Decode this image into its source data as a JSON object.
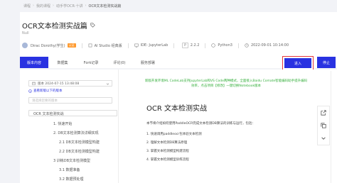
{
  "breadcrumb": [
    "课程",
    "我的课程",
    "动手学OCR·十讲",
    "OCR文本检测实战篇"
  ],
  "project": {
    "title": "OCR文本检测实战篇",
    "subtitle": "Null",
    "author": "Dirac Dorothy(学生)",
    "badge": "认证",
    "env": "AI Studio 经典版",
    "ide": "IDE: JupyterLab",
    "paddle_version": "2.2.2",
    "python": "Python3",
    "date": "2022-09-01 10:14:00"
  },
  "tabs": [
    {
      "label": "版本内容",
      "active": true
    },
    {
      "label": "数据集",
      "active": false
    },
    {
      "label": "Fork记录",
      "active": false
    },
    {
      "label": "评论(0)",
      "active": false
    },
    {
      "label": "服务部署",
      "active": false
    }
  ],
  "actions": {
    "enter_label": "进入",
    "stop_label": "停止"
  },
  "sidebar": {
    "version_time": "版本 2024-07-15 13:48:08",
    "view_old": "查看新版以下的版本",
    "search_placeholder": "请选择您要的版本",
    "toc": [
      "OCR 文本检测实战",
      "1. 快速开始",
      "2. DB文本检测算法详细实现",
      "2.1 DB文本检测模型构建",
      "2.2 DB文本检测模型构建",
      "3 训练DB文本检测模型",
      "3.1 数据准备",
      "3.2 数据预处理"
    ]
  },
  "content": {
    "notice_line1": "新版开发环境ML CodeLab支持JupyterLab和VS Code两种模式，全面接入Baidu Comate智能编码助手提升编码",
    "notice_line2": "效率，点击项目【修改】一键切换Notebook版本",
    "title": "OCR 文本检测实战",
    "intro": "本节将介绍如何使用PaddleOCR完成文本检测DB算法的训练与运行，包括：",
    "list": [
      "1. 快速调用paddleocr包体验文本检测",
      "2. 理解文本检测DB算法原理",
      "3. 掌握文本检测模型构建流程",
      "4. 掌握文本检测模型训练流程"
    ]
  },
  "colors": {
    "primary": "#2932e1",
    "notice": "#38b03f",
    "highlight_border": "#e5383b"
  }
}
